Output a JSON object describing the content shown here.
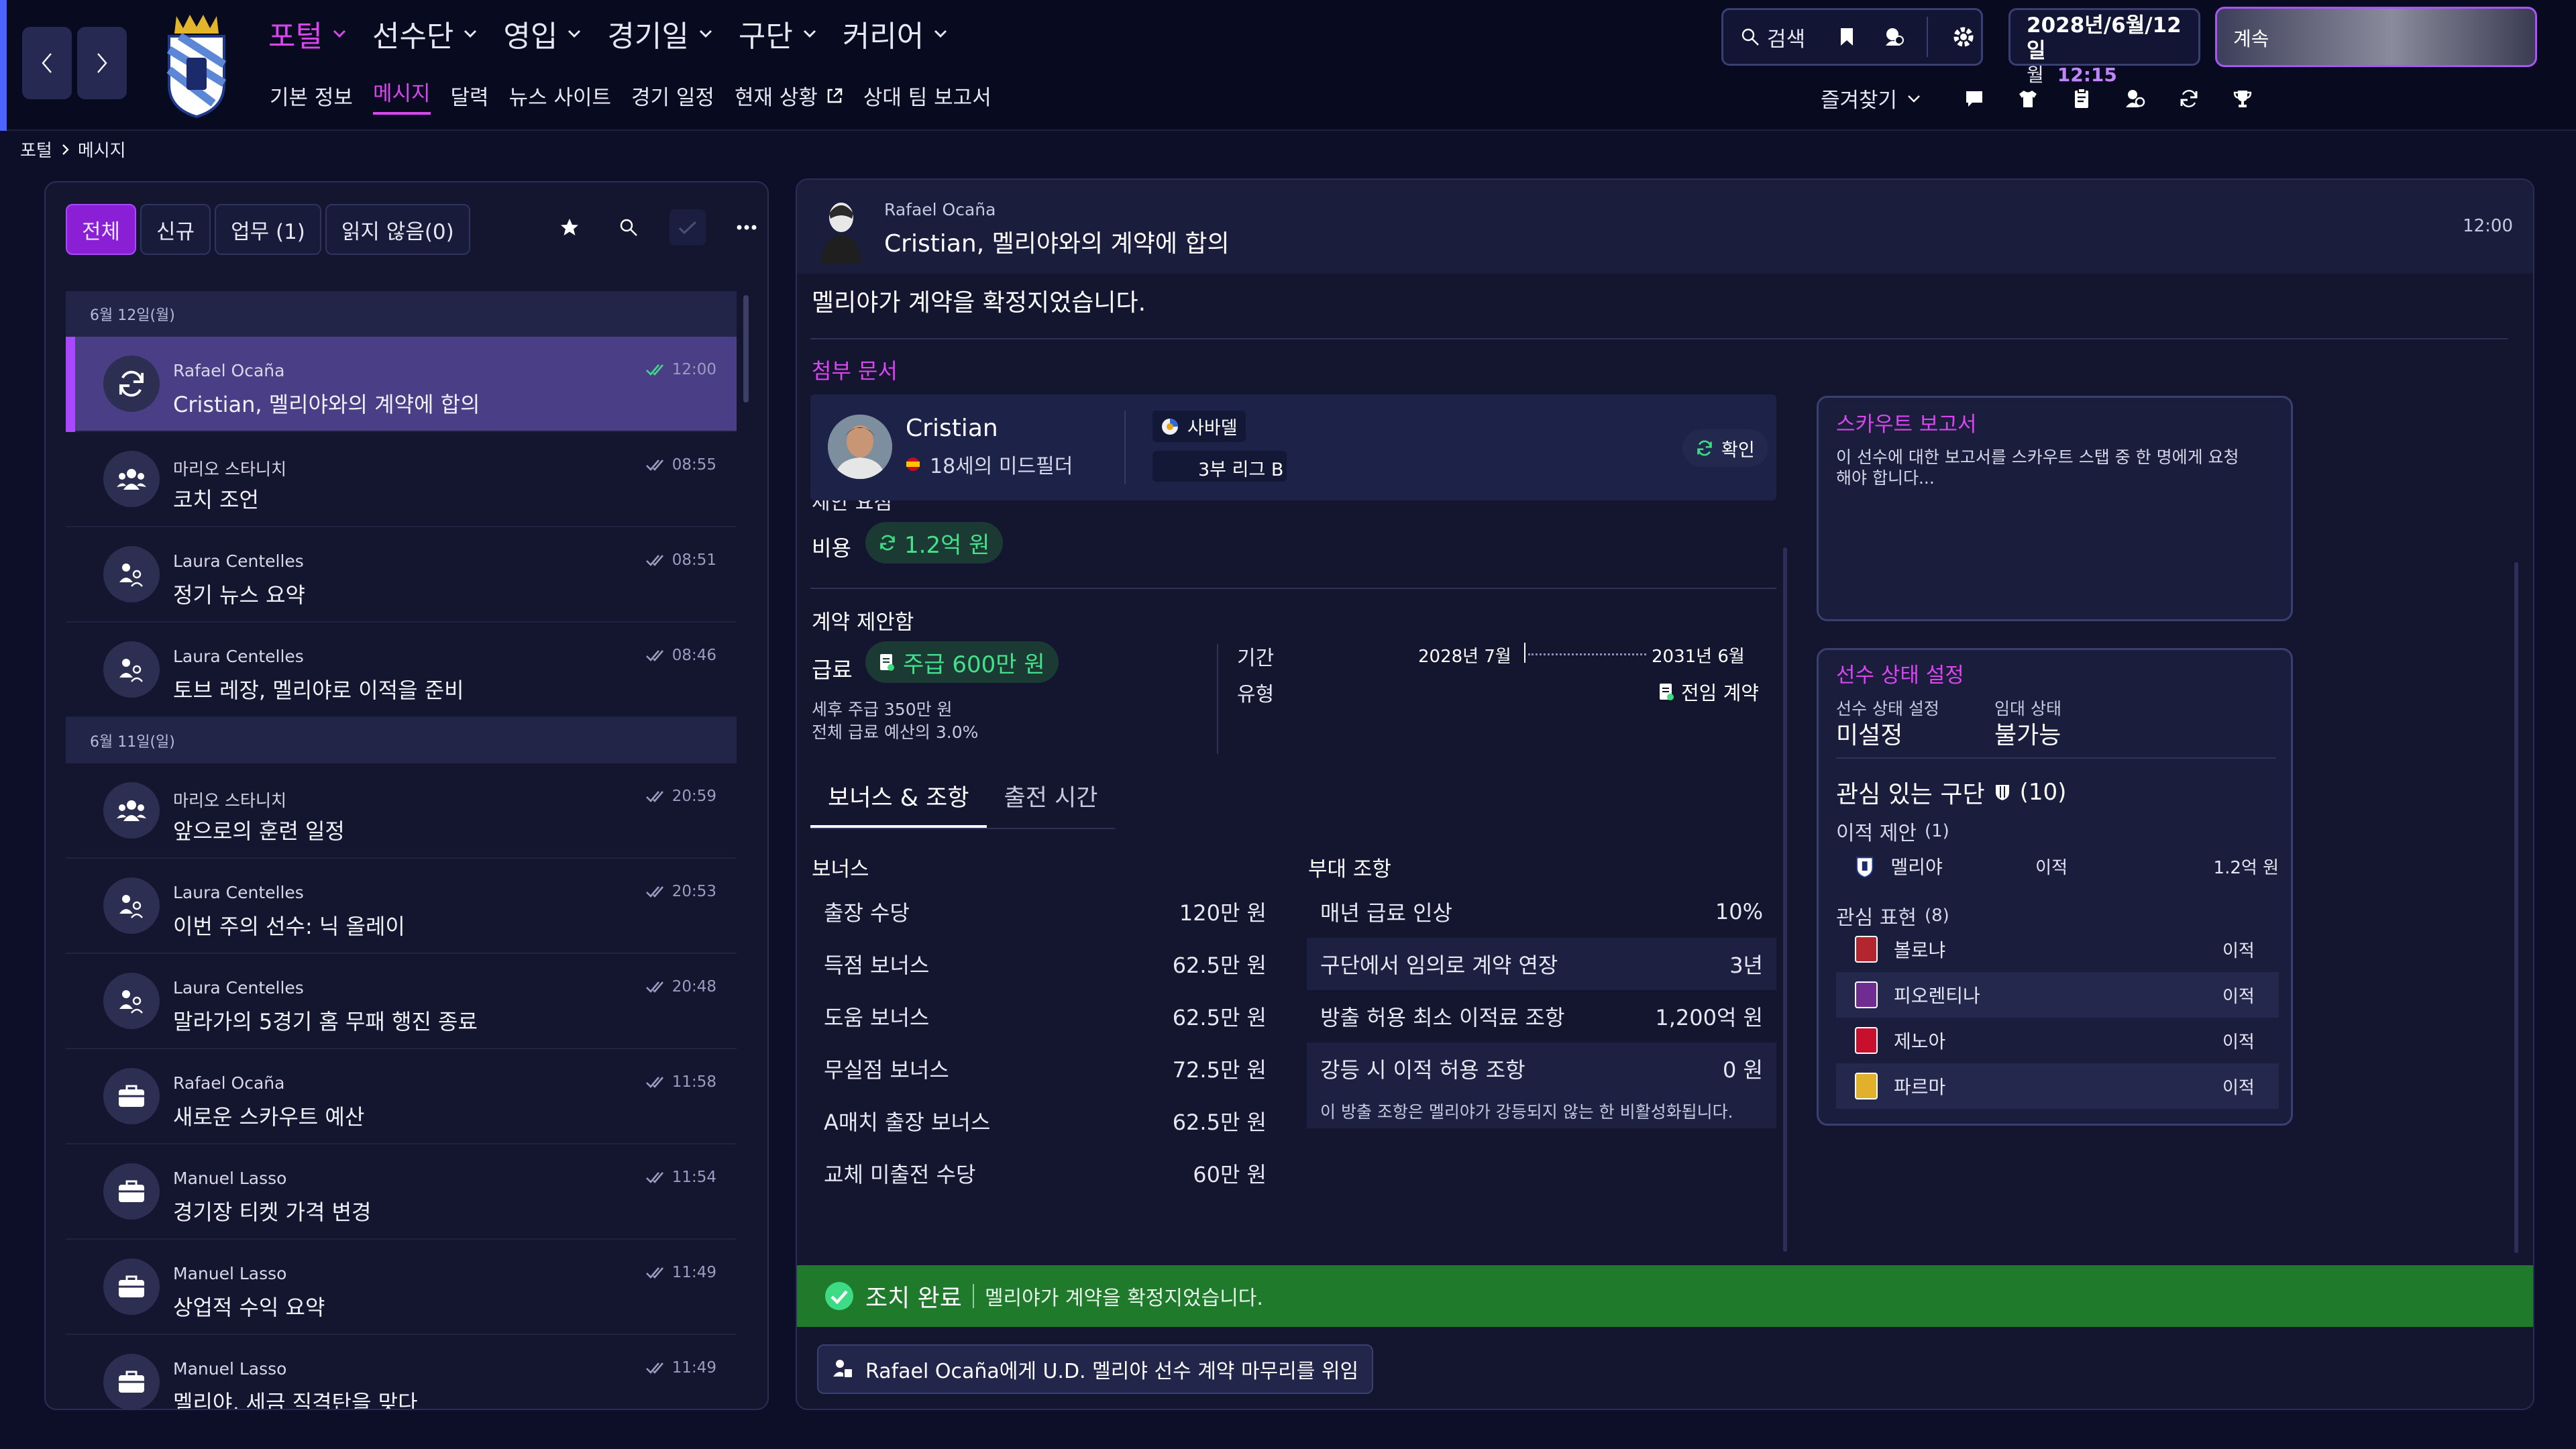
{
  "top_nav": {
    "main": [
      {
        "label": "포털",
        "active": true
      },
      {
        "label": "선수단",
        "active": false
      },
      {
        "label": "영입",
        "active": false
      },
      {
        "label": "경기일",
        "active": false
      },
      {
        "label": "구단",
        "active": false
      },
      {
        "label": "커리어",
        "active": false
      }
    ],
    "sub": [
      {
        "label": "기본 정보",
        "active": false
      },
      {
        "label": "메시지",
        "active": true
      },
      {
        "label": "달력",
        "active": false
      },
      {
        "label": "뉴스 사이트",
        "active": false
      },
      {
        "label": "경기 일정",
        "active": false
      },
      {
        "label": "현재 상황",
        "active": false
      },
      {
        "label": "상대 팀 보고서",
        "active": false
      }
    ],
    "search_label": "검색",
    "date": "2028년/6월/12일",
    "weekday": "월",
    "time": "12:15",
    "continue_label": "계속",
    "favorites_label": "즐겨찾기"
  },
  "breadcrumb": {
    "root": "포털",
    "current": "메시지"
  },
  "inbox": {
    "tabs": [
      {
        "label": "전체",
        "active": true
      },
      {
        "label": "신규",
        "active": false
      },
      {
        "label": "업무 (1)",
        "active": false
      },
      {
        "label": "읽지 않음(0)",
        "active": false
      }
    ],
    "groups": [
      {
        "date": "6월 12일(월)",
        "messages": [
          {
            "sender": "Rafael Ocaña",
            "subject": "Cristian, 멜리야와의 계약에 합의",
            "time": "12:00",
            "icon": "refresh-icon",
            "selected": true
          },
          {
            "sender": "마리오 스타니치",
            "subject": "코치 조언",
            "time": "08:55",
            "icon": "group-icon"
          },
          {
            "sender": "Laura Centelles",
            "subject": "정기 뉴스 요약",
            "time": "08:51",
            "icon": "people-icon"
          },
          {
            "sender": "Laura Centelles",
            "subject": "토브 레장, 멜리야로 이적을 준비",
            "time": "08:46",
            "icon": "people-icon"
          }
        ]
      },
      {
        "date": "6월 11일(일)",
        "messages": [
          {
            "sender": "마리오 스타니치",
            "subject": "앞으로의 훈련 일정",
            "time": "20:59",
            "icon": "group-icon"
          },
          {
            "sender": "Laura Centelles",
            "subject": "이번 주의 선수: 닉 올레이",
            "time": "20:53",
            "icon": "people-icon"
          },
          {
            "sender": "Laura Centelles",
            "subject": "말라가의 5경기 홈 무패 행진 종료",
            "time": "20:48",
            "icon": "people-icon"
          },
          {
            "sender": "Rafael Ocaña",
            "subject": "새로운 스카우트 예산",
            "time": "11:58",
            "icon": "briefcase-icon"
          },
          {
            "sender": "Manuel Lasso",
            "subject": "경기장 티켓 가격 변경",
            "time": "11:54",
            "icon": "briefcase-icon"
          },
          {
            "sender": "Manuel Lasso",
            "subject": "상업적 수익 요약",
            "time": "11:49",
            "icon": "briefcase-icon"
          },
          {
            "sender": "Manuel Lasso",
            "subject": "멜리야, 세금 직격탄을 맞다",
            "time": "11:49",
            "icon": "briefcase-icon"
          }
        ]
      }
    ]
  },
  "message": {
    "sender": "Rafael Ocaña",
    "subject": "Cristian, 멜리야와의 계약에 합의",
    "time": "12:00",
    "body": "멜리야가 계약을 확정지었습니다.",
    "attachments_label": "첨부 문서",
    "player": {
      "name": "Cristian",
      "desc": "18세의 미드필더",
      "club": "사바델",
      "league": "3부 리그 B",
      "confirm_label": "확인"
    },
    "proposal_label": "제안 요점",
    "fee_label": "비용",
    "fee_value": "1.2억 원",
    "contract_label": "계약 제안함",
    "wage_label": "급료",
    "wage_value": "주급 600만 원",
    "wage_note1": "세후 주급 350만 원",
    "wage_note2": "전체 급료 예산의 3.0%",
    "period_label": "기간",
    "period_start": "2028년 7월",
    "period_end": "2031년 6월",
    "type_label": "유형",
    "type_value": "전임 계약",
    "tabs": [
      {
        "label": "보너스 & 조항",
        "active": true
      },
      {
        "label": "출전 시간",
        "active": false
      }
    ],
    "bonus_title": "보너스",
    "bonuses": [
      {
        "label": "출장 수당",
        "value": "120만 원"
      },
      {
        "label": "득점 보너스",
        "value": "62.5만 원"
      },
      {
        "label": "도움 보너스",
        "value": "62.5만 원"
      },
      {
        "label": "무실점 보너스",
        "value": "72.5만 원"
      },
      {
        "label": "A매치 출장 보너스",
        "value": "62.5만 원"
      },
      {
        "label": "교체 미출전 수당",
        "value": "60만 원"
      }
    ],
    "clause_title": "부대 조항",
    "clauses": [
      {
        "label": "매년 급료 인상",
        "value": "10%"
      },
      {
        "label": "구단에서 임의로 계약 연장",
        "value": "3년"
      },
      {
        "label": "방출 허용 최소 이적료 조항",
        "value": "1,200억 원"
      },
      {
        "label": "강등 시 이적 허용 조항",
        "value": "0 원"
      }
    ],
    "clause_note": "이 방출 조항은 멜리야가 강등되지 않는 한 비활성화됩니다.",
    "status_title": "조치 완료",
    "status_text": "멜리야가 계약을 확정지었습니다.",
    "delegate_label": "Rafael Ocaña에게 U.D. 멜리야 선수 계약 마무리를 위임"
  },
  "scout": {
    "title": "스카우트 보고서",
    "text": "이 선수에 대한 보고서를 스카우트 스탭 중 한 명에게 요청해야 합니다..."
  },
  "player_status": {
    "title": "선수 상태 설정",
    "status_label": "선수 상태 설정",
    "status_value": "미설정",
    "loan_label": "임대 상태",
    "loan_value": "불가능",
    "interested_title": "관심 있는 구단",
    "interested_count": "(10)",
    "offers_label": "이적 제안",
    "offers_count": "(1)",
    "offers": [
      {
        "club": "멜리야",
        "type": "이적",
        "value": "1.2억 원"
      }
    ],
    "interest_label": "관심 표현",
    "interest_count": "(8)",
    "interests": [
      {
        "club": "볼로냐",
        "type": "이적",
        "color": "#b3262f"
      },
      {
        "club": "피오렌티나",
        "type": "이적",
        "color": "#6f2c91"
      },
      {
        "club": "제노아",
        "type": "이적",
        "color": "#c8102e"
      },
      {
        "club": "파르마",
        "type": "이적",
        "color": "#e1b12c"
      }
    ]
  }
}
